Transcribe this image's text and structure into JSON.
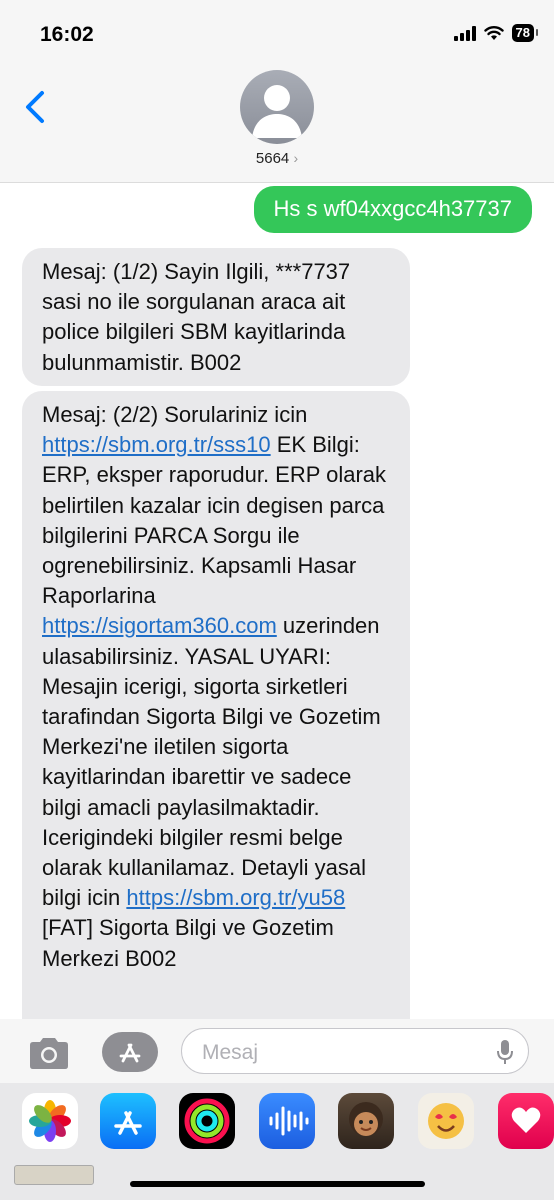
{
  "watermark_id": "#1254478719",
  "status_bar": {
    "time": "16:02",
    "battery": "78",
    "icons": [
      "signal-icon",
      "wifi-icon",
      "battery-icon"
    ]
  },
  "header": {
    "contact_name": "5664",
    "chevron": "›",
    "back_icon": "chevron-left-icon",
    "avatar_icon": "person-icon"
  },
  "messages": {
    "outgoing": "Hs s wf04xxgcc4h37737",
    "incoming_1": "Mesaj: (1/2) Sayin Ilgili, ***7737 sasi no ile sorgulanan araca ait police bilgileri SBM kayitlarinda bulunmamistir. B002",
    "incoming_2": {
      "t1": "Mesaj: (2/2) Sorulariniz icin ",
      "link1": "https://sbm.org.tr/sss10",
      "t2": " EK Bilgi: ERP, eksper raporudur. ERP olarak belirtilen kazalar icin degisen parca bilgilerini PARCA Sorgu ile ogrenebilirsiniz. Kapsamli Hasar Raporlarina ",
      "link2": "https://sigortam360.com",
      "t3": " uzerinden ulasabilirsiniz. YASAL UYARI: Mesajin icerigi, sigorta sirketleri tarafindan Sigorta Bilgi ve Gozetim Merkezi'ne iletilen sigorta kayitlarindan ibarettir ve sadece bilgi amacli paylasilmaktadir. Icerigindeki bilgiler resmi belge olarak kullanilamaz. Detayli yasal bilgi icin ",
      "link3": "https://sbm.org.tr/yu58",
      "t4": " [FAT] Sigorta Bilgi ve Gozetim Merkezi B002"
    }
  },
  "input": {
    "placeholder": "Mesaj",
    "camera_icon": "camera-icon",
    "apps_icon": "app-store-icon",
    "mic_icon": "microphone-icon"
  },
  "app_tray": [
    "photos-icon",
    "app-store-icon",
    "fitness-icon",
    "audio-message-icon",
    "memoji-icon",
    "memoji-stickers-icon",
    "digital-touch-icon"
  ],
  "colors": {
    "outgoing_bubble": "#34c759",
    "incoming_bubble": "#e9e9eb",
    "link": "#1f6ec7",
    "accent": "#007aff"
  }
}
